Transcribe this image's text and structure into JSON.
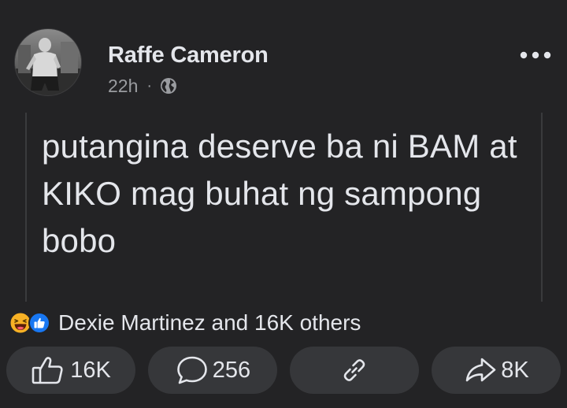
{
  "post": {
    "author": "Raffe Cameron",
    "time": "22h",
    "separator": "·",
    "privacy_icon": "globe-icon",
    "text": "putangina deserve ba ni BAM at KIKO mag buhat ng sampong bobo"
  },
  "reactions": {
    "icons": [
      "haha-reaction-icon",
      "like-reaction-icon"
    ],
    "summary": "Dexie Martinez and 16K others"
  },
  "actions": {
    "like_count": "16K",
    "comment_count": "256",
    "share_count": "8K"
  },
  "colors": {
    "background": "#232325",
    "text": "#e4e6eb",
    "meta": "#9a9ca0",
    "button_bg": "#36373a",
    "like_blue": "#1877f2",
    "haha_yellow": "#f7b125"
  }
}
